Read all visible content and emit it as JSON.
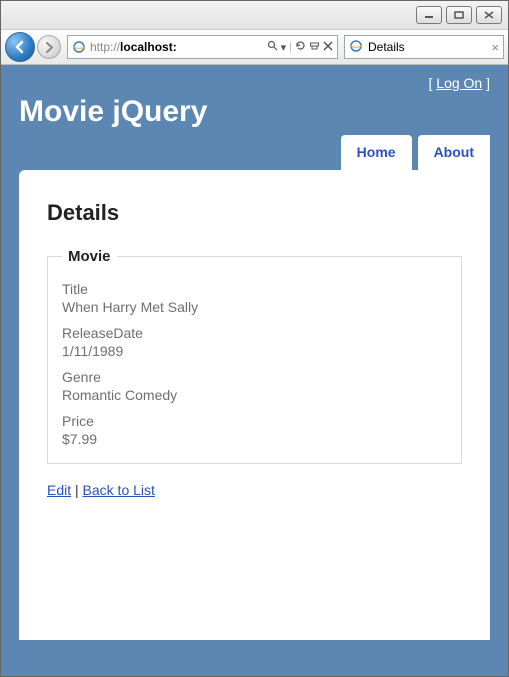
{
  "browser": {
    "url_prefix": "http://",
    "url_host": "localhost:",
    "search_icon_label": "search",
    "tab_title": "Details"
  },
  "header": {
    "logon_text": "Log On",
    "app_title": "Movie jQuery",
    "tabs": {
      "home": "Home",
      "about": "About"
    }
  },
  "page": {
    "heading": "Details",
    "legend": "Movie",
    "fields": {
      "title_label": "Title",
      "title_value": "When Harry Met Sally",
      "release_label": "ReleaseDate",
      "release_value": "1/11/1989",
      "genre_label": "Genre",
      "genre_value": "Romantic Comedy",
      "price_label": "Price",
      "price_value": "$7.99"
    },
    "actions": {
      "edit": "Edit",
      "sep": " | ",
      "back": "Back to List"
    }
  }
}
